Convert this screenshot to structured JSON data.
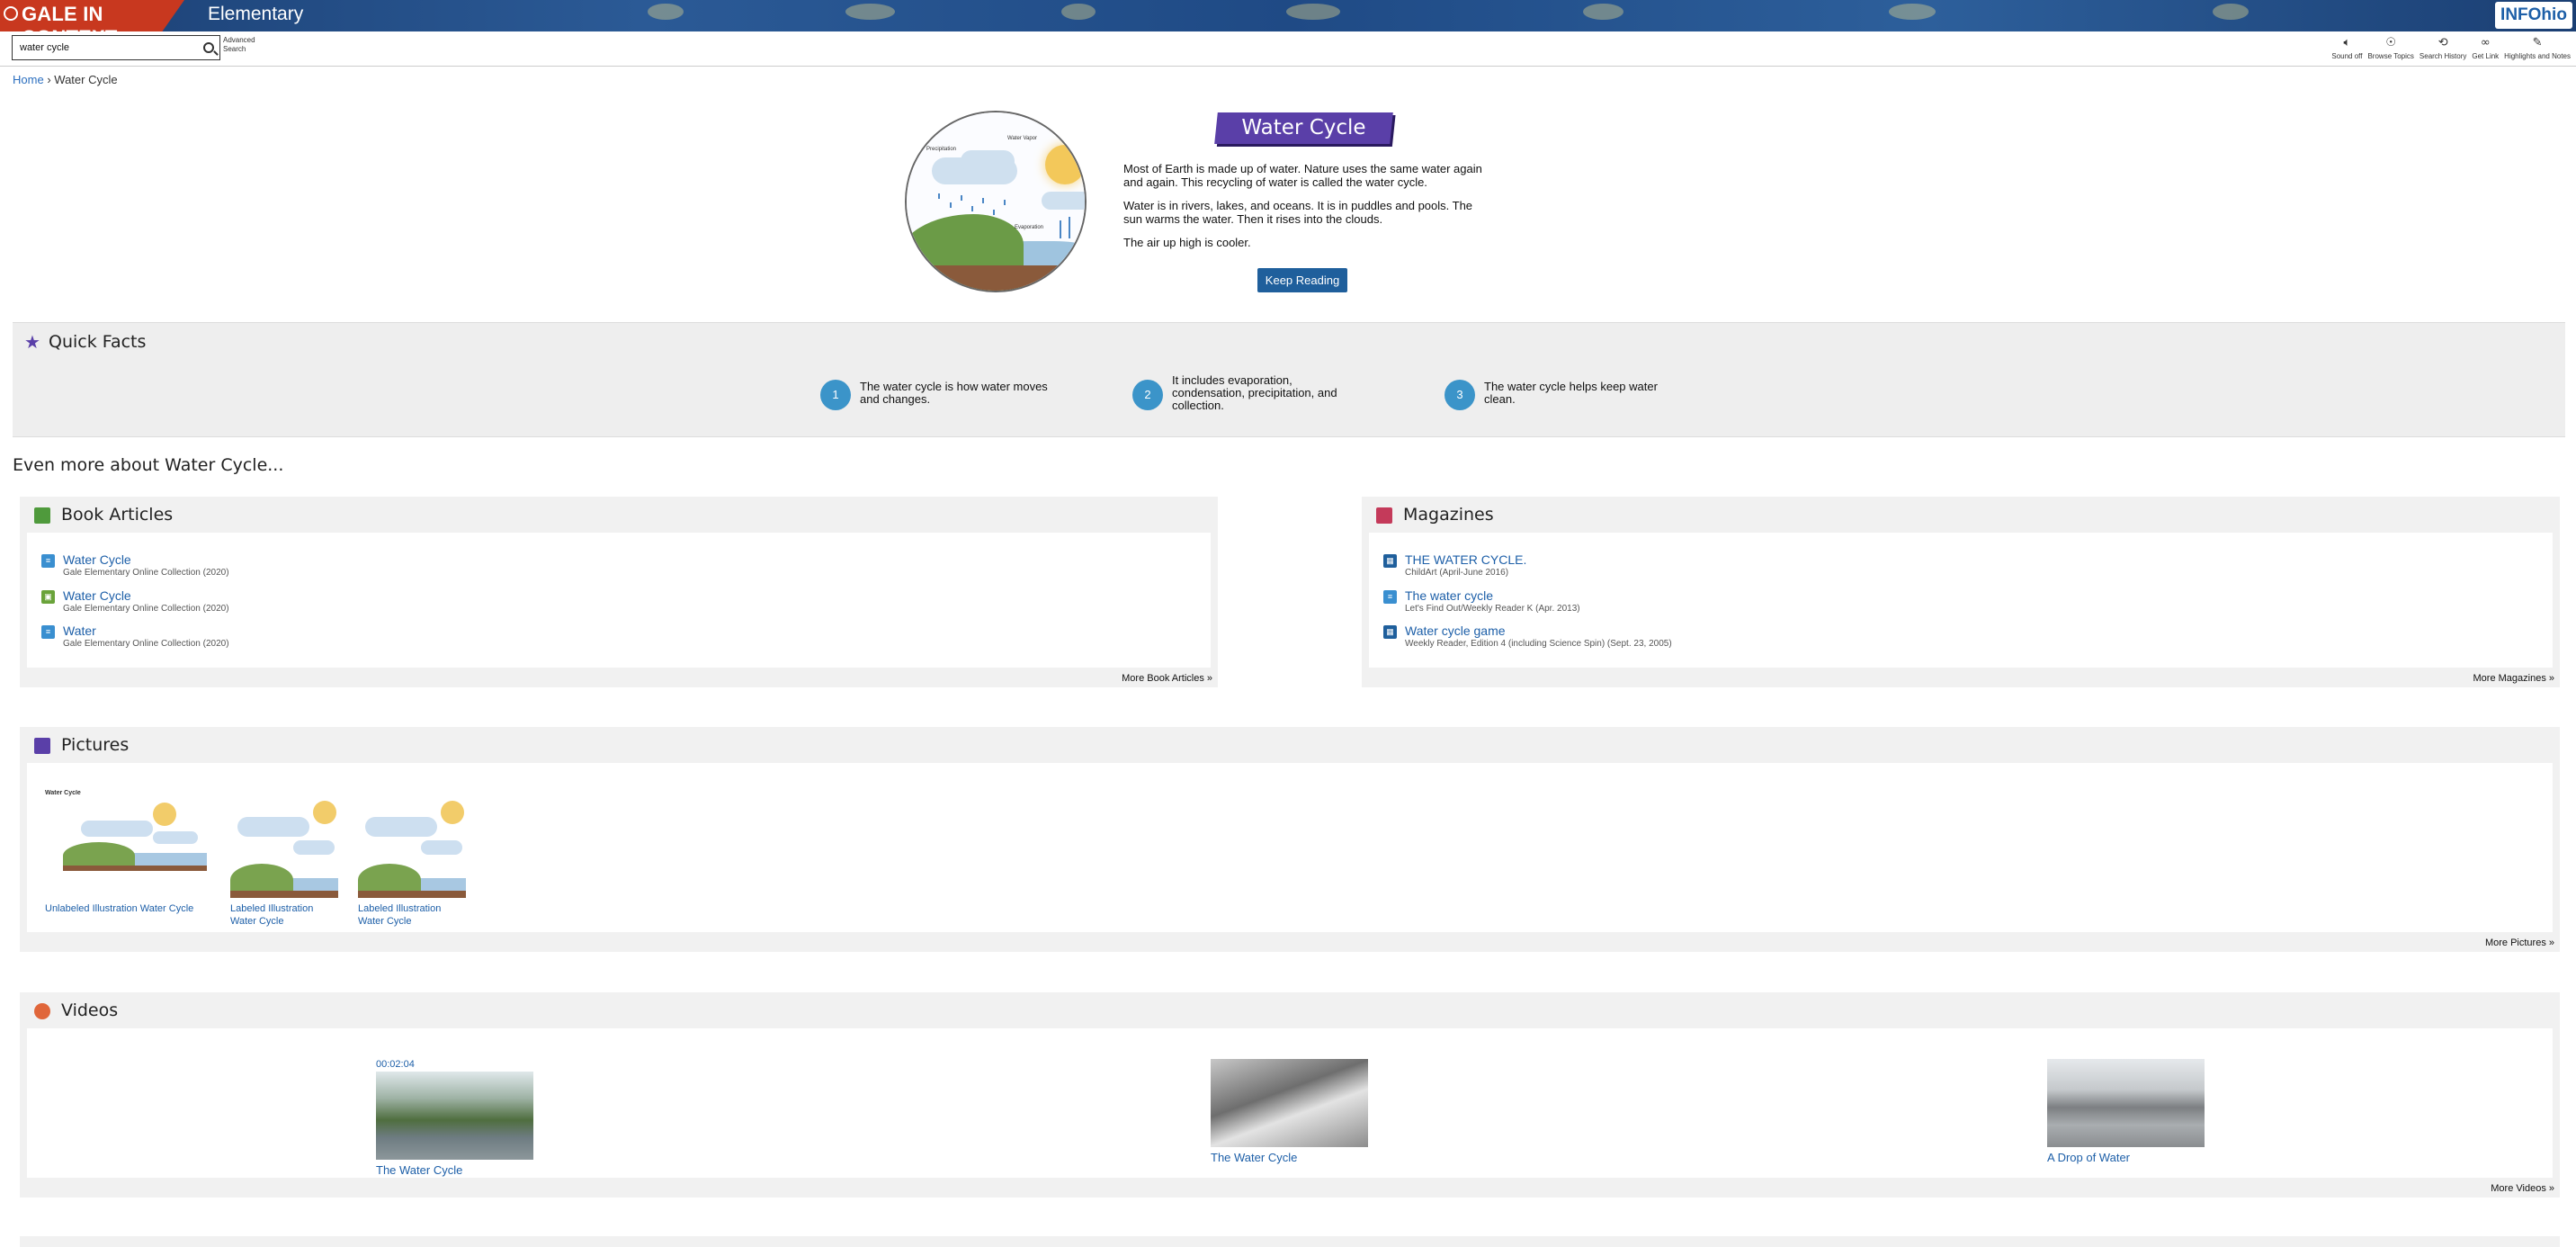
{
  "header": {
    "brand": "GALE IN CONTEXT",
    "edition": "Elementary",
    "partner_logo": "INFOhio"
  },
  "toolbar": {
    "search_value": "water cycle",
    "advanced_search": [
      "Advanced",
      "Search"
    ],
    "tools": [
      {
        "icon": "speaker-icon",
        "label": "Sound off"
      },
      {
        "icon": "lightbulb-icon",
        "label": "Browse Topics"
      },
      {
        "icon": "history-icon",
        "label": "Search History"
      },
      {
        "icon": "link-icon",
        "label": "Get Link"
      },
      {
        "icon": "pencil-icon",
        "label": "Highlights and Notes"
      }
    ]
  },
  "breadcrumb": {
    "home": "Home",
    "separator": "›",
    "current": "Water Cycle"
  },
  "hero": {
    "title": "Water Cycle",
    "image_labels": [
      "Precipitation",
      "Water Vapor",
      "Evaporation"
    ],
    "paragraphs": [
      "Most of Earth is made up of water. Nature uses the same water again and again. This recycling of water is called the water cycle.",
      "Water is in rivers, lakes, and oceans. It is in puddles and pools. The sun warms the water. Then it rises into the clouds.",
      "The air up high is cooler."
    ],
    "keep_reading": "Keep Reading"
  },
  "quick_facts": {
    "title": "Quick Facts",
    "facts": [
      {
        "num": "1",
        "text": "The water cycle is how water moves and changes."
      },
      {
        "num": "2",
        "text": "It includes evaporation, condensation, precipitation, and collection."
      },
      {
        "num": "3",
        "text": "The water cycle helps keep water clean."
      }
    ]
  },
  "more_about": "Even more about Water Cycle...",
  "book_articles": {
    "title": "Book Articles",
    "more": "More Book Articles »",
    "items": [
      {
        "title": "Water Cycle",
        "source": "Gale Elementary Online Collection (2020)"
      },
      {
        "title": "Water Cycle",
        "source": "Gale Elementary Online Collection (2020)"
      },
      {
        "title": "Water",
        "source": "Gale Elementary Online Collection (2020)"
      }
    ]
  },
  "magazines": {
    "title": "Magazines",
    "more": "More Magazines »",
    "items": [
      {
        "title": "THE WATER CYCLE.",
        "source": "ChildArt (April-June 2016)"
      },
      {
        "title": "The water cycle",
        "source": "Let's Find Out/Weekly Reader K (Apr. 2013)"
      },
      {
        "title": "Water cycle game",
        "source": "Weekly Reader, Edition 4 (including Science Spin) (Sept. 23, 2005)"
      }
    ]
  },
  "pictures": {
    "title": "Pictures",
    "more": "More Pictures »",
    "thumb_heading": "Water Cycle",
    "items": [
      {
        "caption": "Unlabeled Illustration Water Cycle"
      },
      {
        "caption": "Labeled Illustration Water Cycle"
      },
      {
        "caption": "Labeled Illustration Water Cycle"
      }
    ]
  },
  "videos": {
    "title": "Videos",
    "more": "More Videos »",
    "items": [
      {
        "title": "The Water Cycle",
        "duration": "00:02:04"
      },
      {
        "title": "The Water Cycle",
        "duration": ""
      },
      {
        "title": "A Drop of Water",
        "duration": ""
      }
    ]
  },
  "colors": {
    "brand_red": "#c8381f",
    "header_blue": "#1f4a85",
    "title_purple": "#5a3fa8",
    "button_blue": "#1f5f9c",
    "link_blue": "#1d5fa8",
    "fact_circle": "#3b94c9",
    "panel_gray": "#f1f1f1"
  }
}
